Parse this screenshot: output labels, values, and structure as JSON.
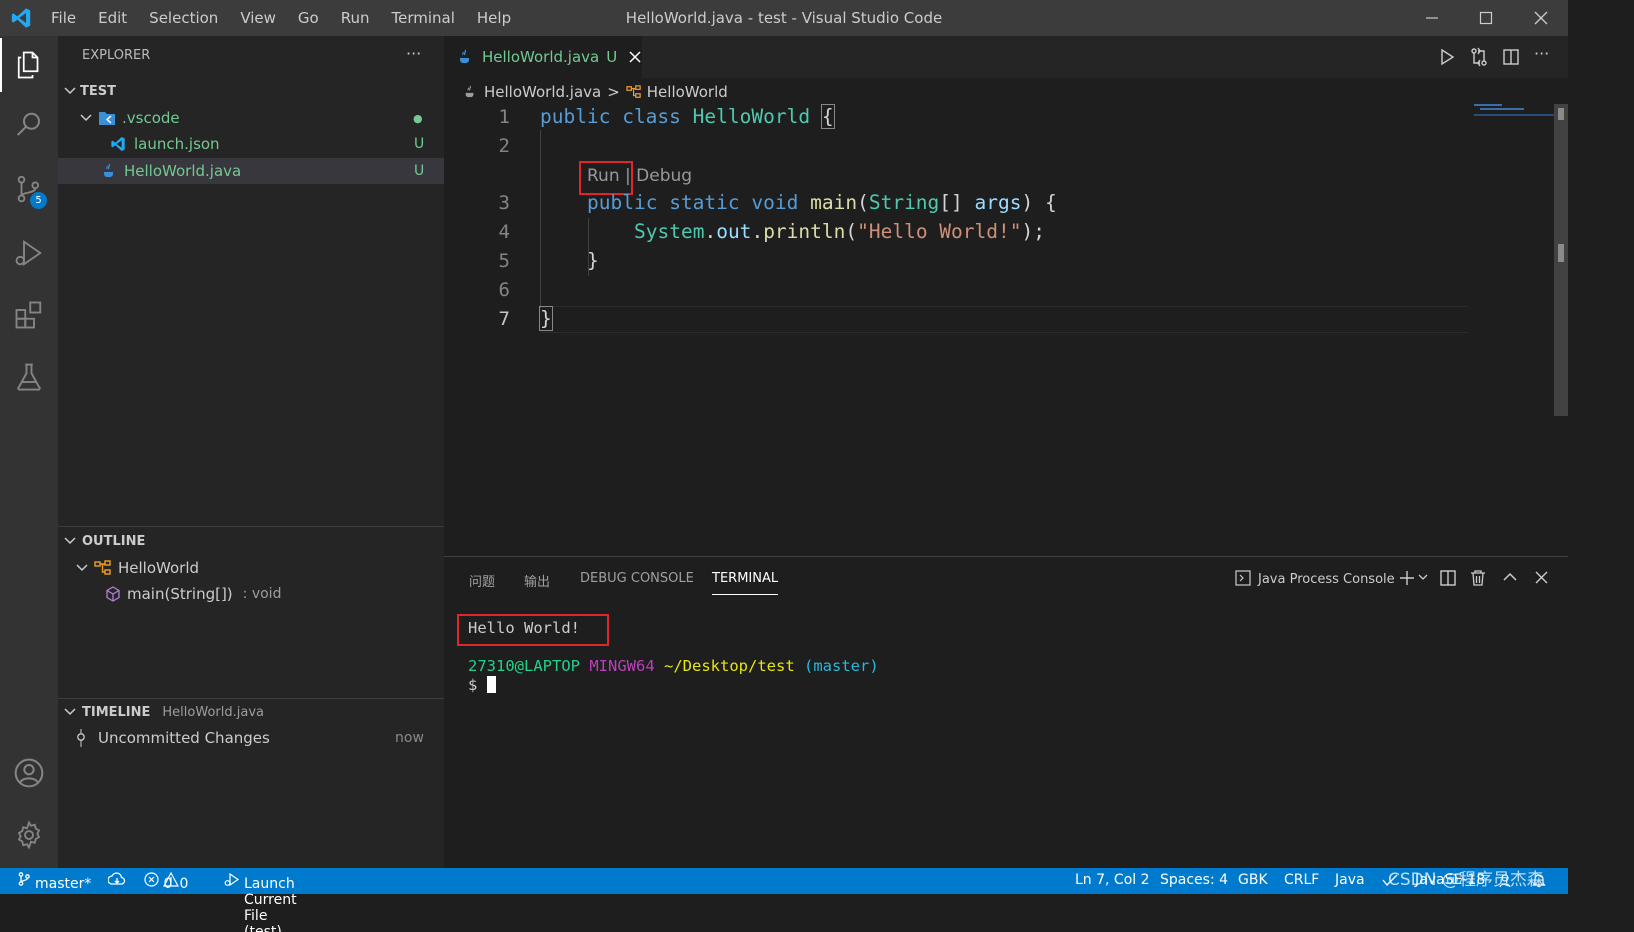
{
  "window": {
    "title": "HelloWorld.java - test - Visual Studio Code",
    "menu": [
      "File",
      "Edit",
      "Selection",
      "View",
      "Go",
      "Run",
      "Terminal",
      "Help"
    ]
  },
  "activity_bar": {
    "scm_badge": "5"
  },
  "explorer": {
    "header": "EXPLORER",
    "more": "···",
    "folder": "TEST",
    "items": [
      {
        "name": ".vscode",
        "status": "●"
      },
      {
        "name": "launch.json",
        "status": "U"
      },
      {
        "name": "HelloWorld.java",
        "status": "U"
      }
    ]
  },
  "outline": {
    "header": "OUTLINE",
    "class_name": "HelloWorld",
    "method": "main(String[])",
    "method_type": ": void"
  },
  "timeline": {
    "header": "TIMELINE",
    "file": "HelloWorld.java",
    "entry": "Uncommitted Changes",
    "time": "now"
  },
  "editor": {
    "tab_label": "HelloWorld.java",
    "tab_status": "U",
    "breadcrumb_file": "HelloWorld.java",
    "breadcrumb_sep": ">",
    "breadcrumb_symbol": "HelloWorld",
    "codelens_run": "Run",
    "codelens_sep": "|",
    "codelens_debug": "Debug",
    "line_numbers": [
      "1",
      "2",
      "3",
      "4",
      "5",
      "6",
      "7"
    ],
    "code": {
      "l1_kw1": "public",
      "l1_kw2": "class",
      "l1_cls": "HelloWorld",
      "l1_brace": "{",
      "l3_kw1": "public",
      "l3_kw2": "static",
      "l3_kw3": "void",
      "l3_fn": "main",
      "l3_open": "(",
      "l3_type": "String",
      "l3_arr": "[]",
      "l3_arg": "args",
      "l3_close": ") {",
      "l4_cls": "System",
      "l4_dot1": ".",
      "l4_var": "out",
      "l4_dot2": ".",
      "l4_fn": "println",
      "l4_open": "(",
      "l4_str": "\"Hello World!\"",
      "l4_close": ");",
      "l5": "}",
      "l7": "}"
    }
  },
  "panel": {
    "tabs": [
      "问题",
      "输出",
      "DEBUG CONSOLE",
      "TERMINAL"
    ],
    "active_tab": "TERMINAL",
    "terminal_selector": "Java Process Console",
    "output_line": "Hello World!",
    "prompt_user": "27310@LAPTOP",
    "prompt_env": "MINGW64",
    "prompt_path": "~/Desktop/test",
    "prompt_branch": "(master)",
    "prompt_symbol": "$"
  },
  "status_bar": {
    "branch": "master*",
    "errors": "0",
    "warnings": "0",
    "launch": "Launch Current File (test)",
    "position": "Ln 7, Col 2",
    "spaces": "Spaces: 4",
    "encoding": "GBK",
    "eol": "CRLF",
    "language": "Java",
    "java_version": "JavaSE-18",
    "watermark": "CSDN @程序员杰森"
  },
  "colors": {
    "accent": "#007acc",
    "untracked": "#73c991",
    "highlight_box": "#e0262b"
  }
}
